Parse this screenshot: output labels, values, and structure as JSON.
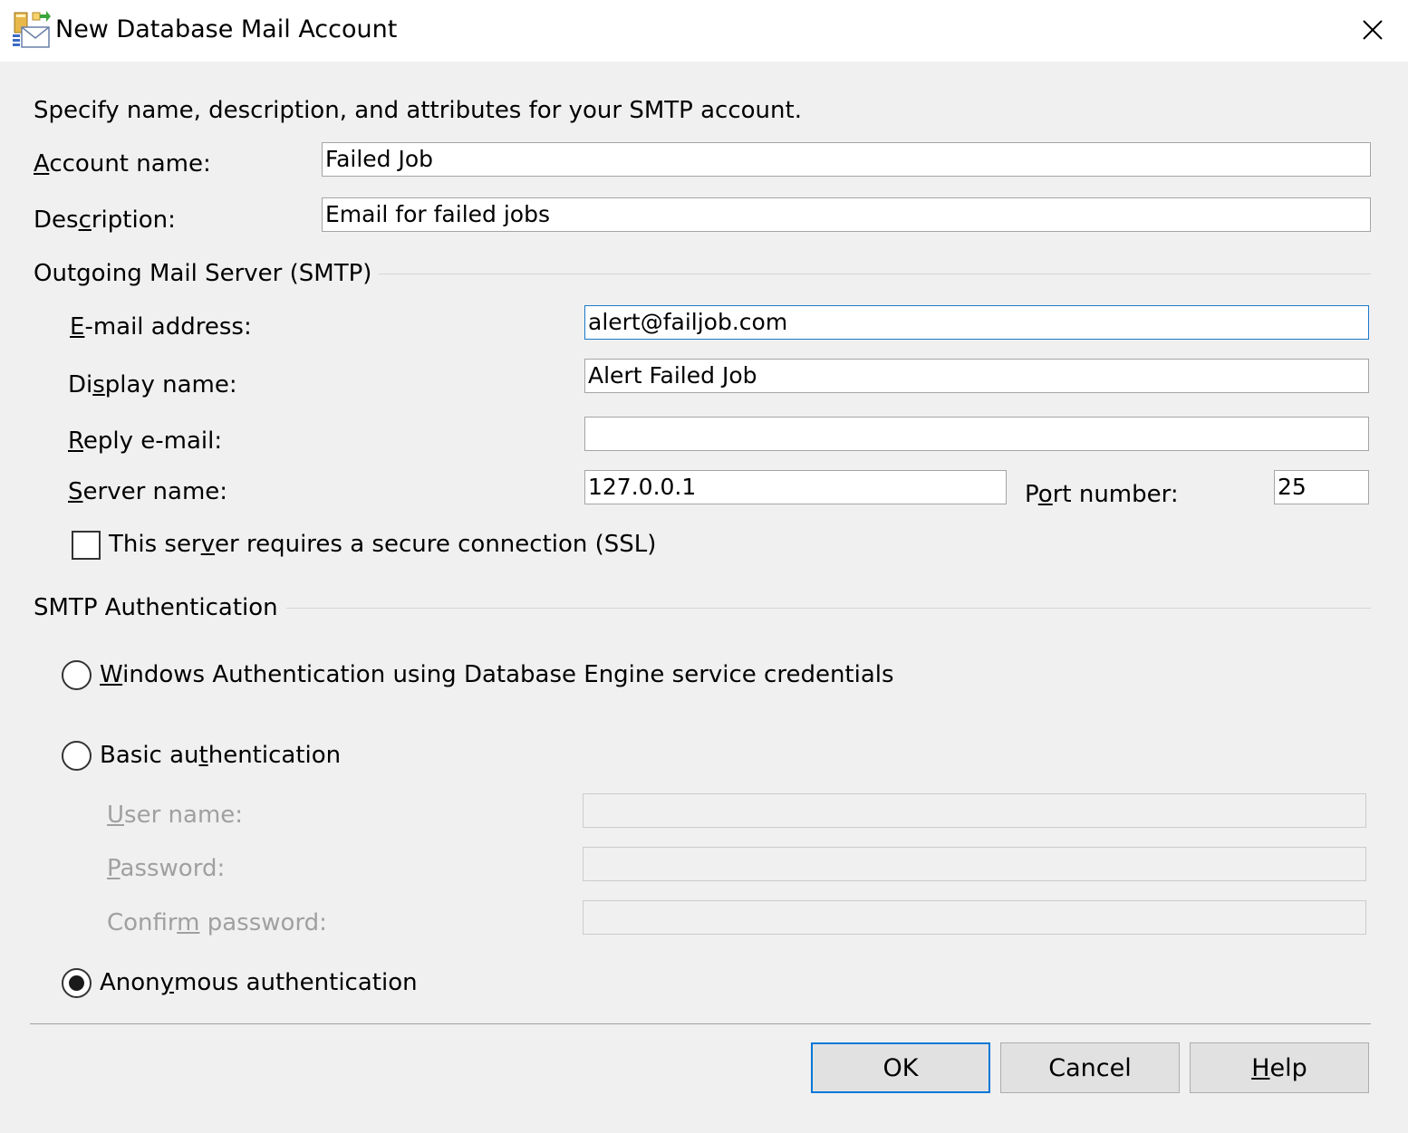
{
  "window": {
    "title": "New Database Mail Account",
    "icon": "database-mail-icon",
    "close_icon": "close-icon"
  },
  "intro": "Specify name, description, and attributes for your SMTP account.",
  "account": {
    "name_label_pre": "",
    "name_label_key": "A",
    "name_label_post": "ccount name:",
    "name_value": "Failed Job",
    "desc_label_pre": "Des",
    "desc_label_key": "c",
    "desc_label_post": "ription:",
    "desc_value": "Email for failed jobs"
  },
  "smtp": {
    "group_title": "Outgoing Mail Server (SMTP)",
    "email_label_pre": "",
    "email_label_key": "E",
    "email_label_post": "-mail address:",
    "email_value": "alert@failjob.com",
    "display_label_pre": "Di",
    "display_label_key": "s",
    "display_label_post": "play name:",
    "display_value": "Alert Failed Job",
    "reply_label_pre": "",
    "reply_label_key": "R",
    "reply_label_post": "eply e-mail:",
    "reply_value": "",
    "server_label_pre": "",
    "server_label_key": "S",
    "server_label_post": "erver name:",
    "server_value": "127.0.0.1",
    "port_label_pre": "P",
    "port_label_key": "o",
    "port_label_post": "rt number:",
    "port_value": "25",
    "ssl_label_pre": "This ser",
    "ssl_label_key": "v",
    "ssl_label_post": "er requires a secure connection (SSL)",
    "ssl_checked": false
  },
  "auth": {
    "group_title": "SMTP Authentication",
    "windows_pre": "",
    "windows_key": "W",
    "windows_post": "indows Authentication using Database Engine service credentials",
    "basic_pre": "Basic au",
    "basic_key": "t",
    "basic_post": "hentication",
    "user_pre": "",
    "user_key": "U",
    "user_post": "ser name:",
    "password_pre": "",
    "password_key": "P",
    "password_post": "assword:",
    "confirm_pre": "Confir",
    "confirm_key": "m",
    "confirm_post": " password:",
    "anon_pre": "Anon",
    "anon_key": "y",
    "anon_post": "mous authentication",
    "selected": "anonymous"
  },
  "buttons": {
    "ok": "OK",
    "cancel": "Cancel",
    "help_key": "H",
    "help_post": "elp"
  }
}
